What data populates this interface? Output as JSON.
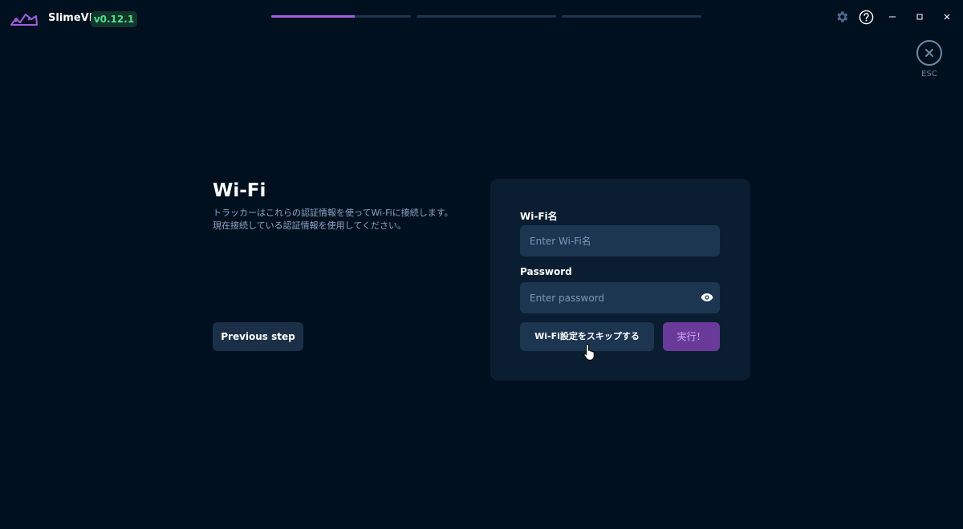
{
  "app": {
    "name": "SlimeVR",
    "version": "v0.12.1"
  },
  "progress_steps": [
    {
      "label": "step-1",
      "fill": 0.6
    },
    {
      "label": "step-2",
      "fill": 0
    },
    {
      "label": "step-3",
      "fill": 0
    }
  ],
  "window_controls": {
    "settings_icon": "gear-icon",
    "help_icon": "question-icon",
    "minimize_icon": "minimize-icon",
    "maximize_icon": "maximize-icon",
    "close_icon": "close-icon"
  },
  "esc": {
    "label": "ESC"
  },
  "page": {
    "title": "Wi-Fi",
    "description_line1": "トラッカーはこれらの認証情報を使ってWi-Fiに接続します。",
    "description_line2": "現在接続している認証情報を使用してください。"
  },
  "buttons": {
    "previous_step": "Previous step",
    "skip_wifi": "Wi-Fi設定をスキップする",
    "submit": "実行！"
  },
  "form": {
    "ssid_label": "Wi-Fi名",
    "ssid_placeholder": "Enter Wi-Fi名",
    "ssid_value": "",
    "password_label": "Password",
    "password_placeholder": "Enter password",
    "password_value": ""
  },
  "colors": {
    "background": "#00101f",
    "card": "#0b1d30",
    "input": "#1c3551",
    "accent_purple": "#a25ee0",
    "submit_button": "#6a3a9b",
    "version_text": "#4fe08a"
  }
}
